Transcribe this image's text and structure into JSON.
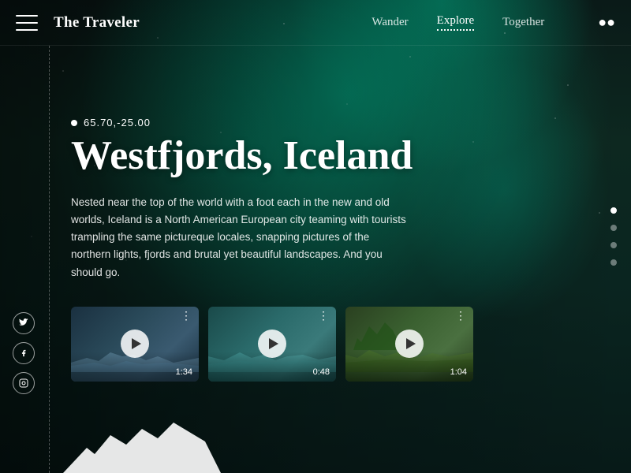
{
  "app": {
    "title": "The Traveler"
  },
  "navbar": {
    "menu_label": "menu",
    "logo": "The Traveler",
    "links": [
      {
        "label": "Wander",
        "active": false
      },
      {
        "label": "Explore",
        "active": true
      },
      {
        "label": "Together",
        "active": false
      }
    ],
    "search_label": "search"
  },
  "hero": {
    "coordinates": "65.70,-25.00",
    "title": "Westfjords, Iceland",
    "description": "Nested near the top of the world with a foot each in the new and old worlds, Iceland is a North American European city teaming with tourists trampling the same pictureque locales, snapping pictures of the northern lights, fjords and brutal yet beautiful landscapes. And you should go."
  },
  "videos": [
    {
      "duration": "1:34",
      "options": "..."
    },
    {
      "duration": "0:48",
      "options": "..."
    },
    {
      "duration": "1:04",
      "options": "..."
    }
  ],
  "dots": [
    {
      "active": true
    },
    {
      "active": false
    },
    {
      "active": false
    },
    {
      "active": false
    }
  ],
  "social": [
    {
      "icon": "twitter",
      "label": "Twitter"
    },
    {
      "icon": "facebook",
      "label": "Facebook"
    },
    {
      "icon": "instagram",
      "label": "Instagram"
    }
  ]
}
